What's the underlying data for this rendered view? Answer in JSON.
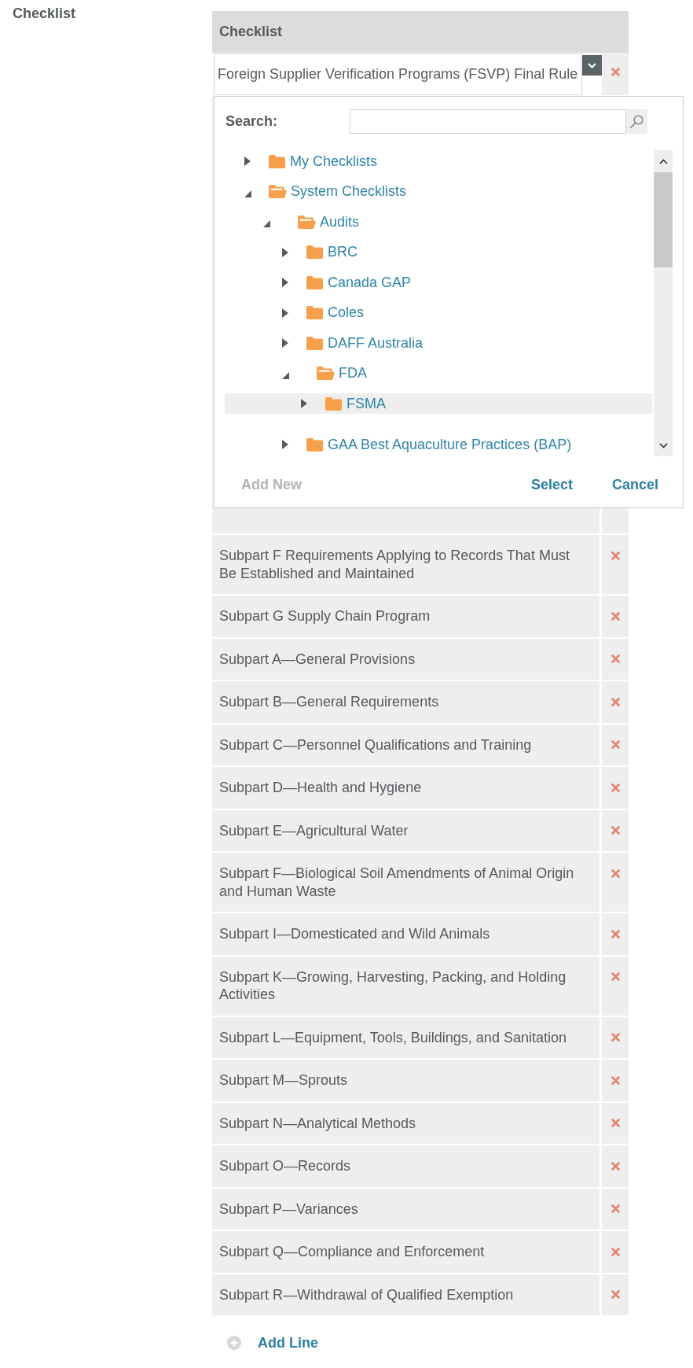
{
  "field_label": "Checklist",
  "table": {
    "header": "Checklist",
    "select": {
      "value": "Foreign Supplier Verification Programs (FSVP) Final Rule"
    },
    "rows": [
      {
        "text": "Subpart F Requirements Applying to Records That Must Be Established and Maintained"
      },
      {
        "text": "Subpart G Supply Chain Program"
      },
      {
        "text": "Subpart A—General Provisions"
      },
      {
        "text": "Subpart B—General Requirements"
      },
      {
        "text": "Subpart C—Personnel Qualifications and Training"
      },
      {
        "text": "Subpart D—Health and Hygiene"
      },
      {
        "text": "Subpart E—Agricultural Water"
      },
      {
        "text": "Subpart F—Biological Soil Amendments of Animal Origin and Human Waste"
      },
      {
        "text": "Subpart I—Domesticated and Wild Animals"
      },
      {
        "text": "Subpart K—Growing, Harvesting, Packing, and Holding Activities"
      },
      {
        "text": "Subpart L—Equipment, Tools, Buildings, and Sanitation"
      },
      {
        "text": "Subpart M—Sprouts"
      },
      {
        "text": "Subpart N—Analytical Methods"
      },
      {
        "text": "Subpart O—Records"
      },
      {
        "text": "Subpart P—Variances"
      },
      {
        "text": "Subpart Q—Compliance and Enforcement"
      },
      {
        "text": "Subpart R—Withdrawal of Qualified Exemption"
      }
    ]
  },
  "picker": {
    "search_label": "Search:",
    "tree": [
      {
        "label": "My Checklists",
        "expanded": false,
        "selected": false
      },
      {
        "label": "System Checklists",
        "expanded": true,
        "selected": false,
        "children": [
          {
            "label": "Audits",
            "expanded": true,
            "selected": false,
            "children": [
              {
                "label": "BRC",
                "expanded": false,
                "selected": false
              },
              {
                "label": "Canada GAP",
                "expanded": false,
                "selected": false
              },
              {
                "label": "Coles",
                "expanded": false,
                "selected": false
              },
              {
                "label": "DAFF Australia",
                "expanded": false,
                "selected": false
              },
              {
                "label": "FDA",
                "expanded": true,
                "selected": false,
                "children": [
                  {
                    "label": "FSMA",
                    "expanded": false,
                    "selected": true
                  }
                ]
              },
              {
                "label": "GAA Best Aquaculture Practices (BAP)",
                "expanded": false,
                "selected": false
              }
            ]
          }
        ]
      }
    ],
    "add_new": {
      "label": "Add New",
      "disabled": true
    },
    "buttons": [
      {
        "label": "Select"
      },
      {
        "label": "Cancel"
      }
    ]
  },
  "add_line": {
    "label": "Add Line"
  }
}
